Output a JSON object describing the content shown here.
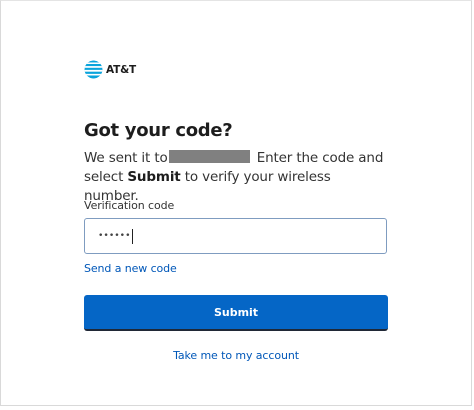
{
  "brand": {
    "name": "AT&T",
    "logo_icon": "att-globe-icon",
    "color": "#0aa4dc"
  },
  "form": {
    "title": "Got your code?",
    "description_part1": "We sent it to",
    "description_part2": " Enter the code and select ",
    "description_bold": "Submit",
    "description_part3": " to verify your wireless number.",
    "field_label": "Verification code",
    "field_value": "••••••",
    "resend_link": "Send a new code",
    "submit_label": "Submit",
    "account_link": "Take me to my account"
  },
  "colors": {
    "primary_button": "#0566c6",
    "link": "#0057b8",
    "input_border": "#7f9cc0"
  }
}
